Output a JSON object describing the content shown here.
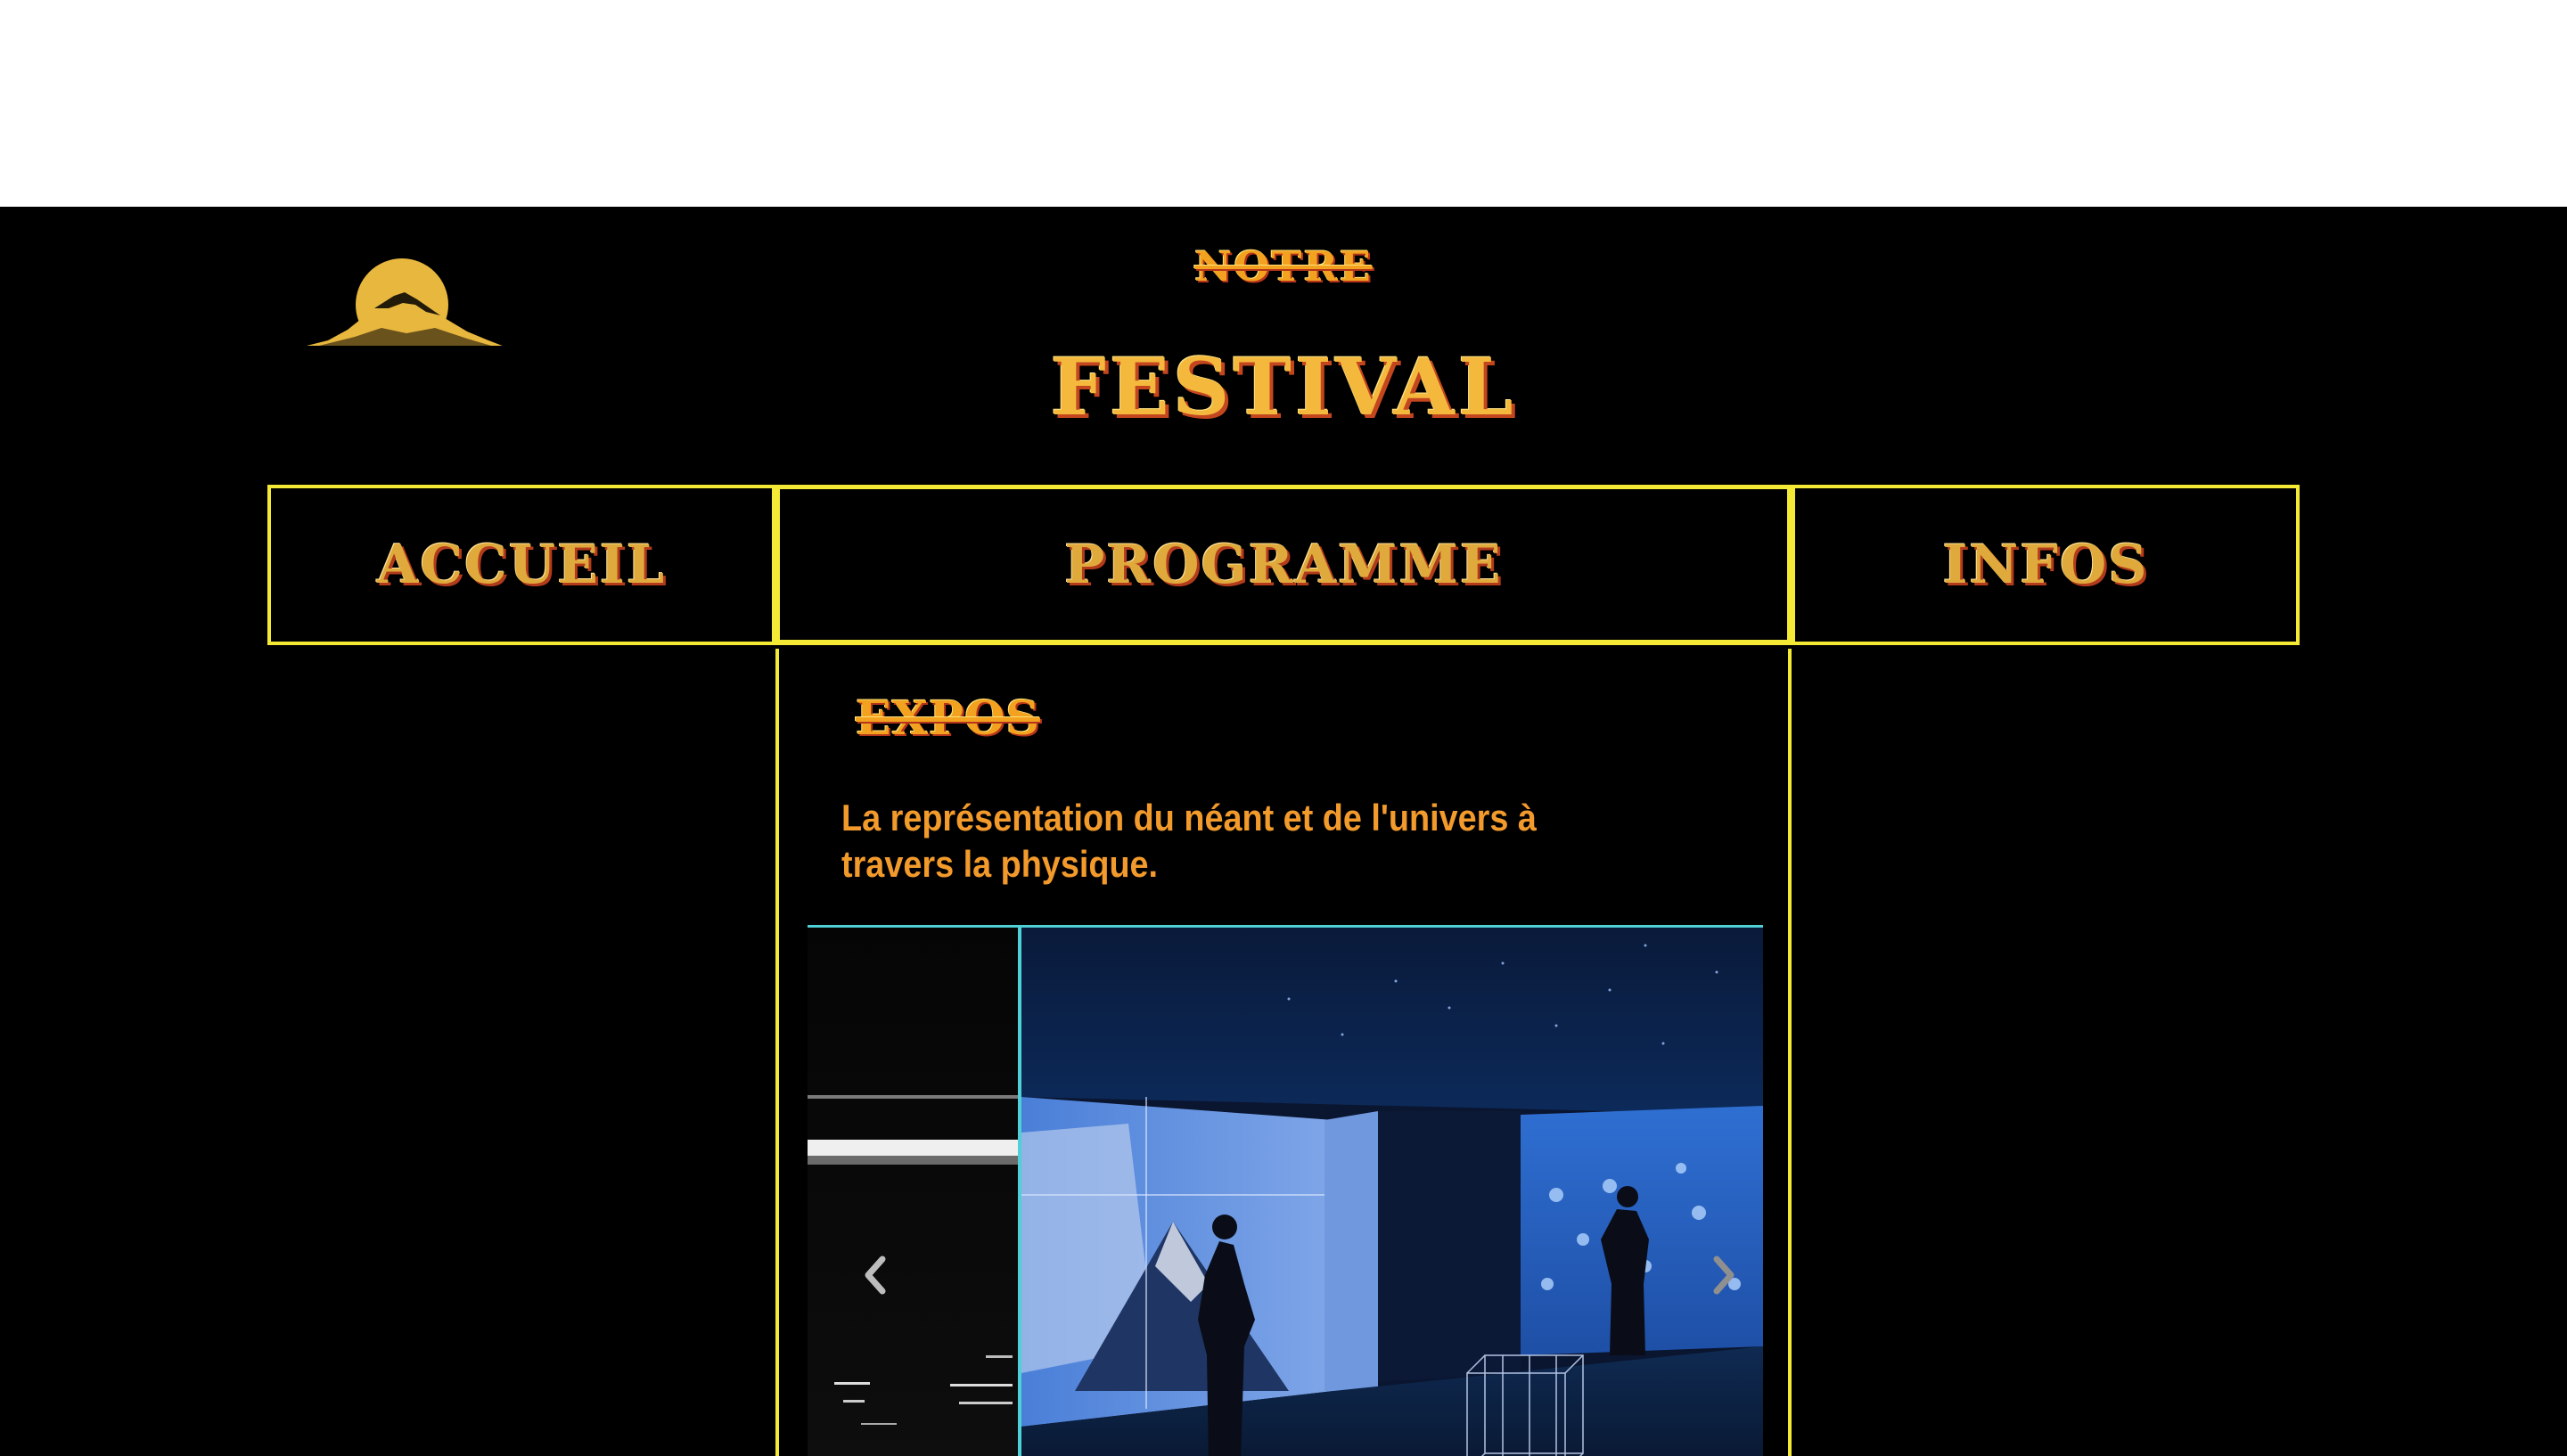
{
  "header": {
    "logo_icon": "mountain-sun-logo",
    "title_top": "NOTRE",
    "title_main": "FESTIVAL"
  },
  "nav": {
    "items": [
      {
        "label": "ACCUEIL"
      },
      {
        "label": "PROGRAMME"
      },
      {
        "label": "INFOS"
      }
    ]
  },
  "section": {
    "heading": "EXPOS",
    "description": "La représentation du néant et de l'univers à travers la physique."
  },
  "carousel": {
    "prev_icon": "chevron-left-icon",
    "next_icon": "chevron-right-icon"
  },
  "colors": {
    "background": "#000000",
    "accent_border": "#f4e934",
    "title_orange": "#f2a21e",
    "text_orange": "#f29a2b",
    "carousel_border": "#4fd0d6"
  }
}
